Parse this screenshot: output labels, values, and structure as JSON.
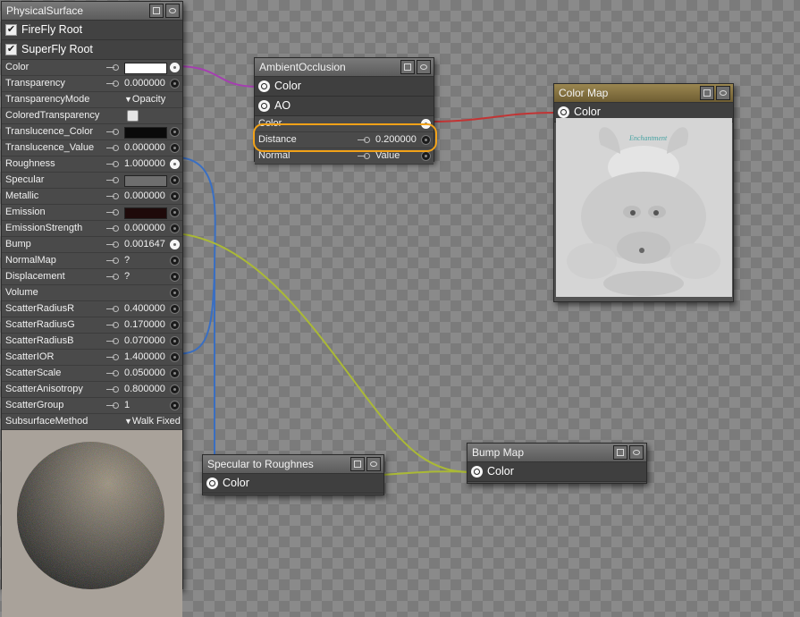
{
  "physical_surface": {
    "title": "PhysicalSurface",
    "headers": [
      {
        "label": "FireFly Root",
        "checked": true
      },
      {
        "label": "SuperFly Root",
        "checked": true
      }
    ],
    "props": [
      {
        "label": "Color",
        "kind": "swatch",
        "color": "#ffffff",
        "socket": "out"
      },
      {
        "label": "Transparency",
        "kind": "value",
        "value": "0.000000",
        "socket": "in"
      },
      {
        "label": "TransparencyMode",
        "kind": "dropdown",
        "value": "Opacity"
      },
      {
        "label": "ColoredTransparency",
        "kind": "checkbox"
      },
      {
        "label": "Translucence_Color",
        "kind": "swatch",
        "color": "#0a0a0a",
        "socket": "in"
      },
      {
        "label": "Translucence_Value",
        "kind": "value",
        "value": "0.000000",
        "socket": "in"
      },
      {
        "label": "Roughness",
        "kind": "value",
        "value": "1.000000",
        "socket": "out"
      },
      {
        "label": "Specular",
        "kind": "swatch",
        "color": "#6e6e6e",
        "socket": "in"
      },
      {
        "label": "Metallic",
        "kind": "value",
        "value": "0.000000",
        "socket": "in"
      },
      {
        "label": "Emission",
        "kind": "swatch",
        "color": "#1e0a0a",
        "socket": "in"
      },
      {
        "label": "EmissionStrength",
        "kind": "value",
        "value": "0.000000",
        "socket": "in"
      },
      {
        "label": "Bump",
        "kind": "value",
        "value": "0.001647",
        "socket": "out"
      },
      {
        "label": "NormalMap",
        "kind": "value",
        "value": "?",
        "socket": "in"
      },
      {
        "label": "Displacement",
        "kind": "value",
        "value": "?",
        "socket": "in"
      },
      {
        "label": "Volume",
        "kind": "none",
        "socket": "in"
      },
      {
        "label": "ScatterRadiusR",
        "kind": "value",
        "value": "0.400000",
        "socket": "in"
      },
      {
        "label": "ScatterRadiusG",
        "kind": "value",
        "value": "0.170000",
        "socket": "in"
      },
      {
        "label": "ScatterRadiusB",
        "kind": "value",
        "value": "0.070000",
        "socket": "in"
      },
      {
        "label": "ScatterIOR",
        "kind": "value",
        "value": "1.400000",
        "socket": "in"
      },
      {
        "label": "ScatterScale",
        "kind": "value",
        "value": "0.050000",
        "socket": "in"
      },
      {
        "label": "ScatterAnisotropy",
        "kind": "value",
        "value": "0.800000",
        "socket": "in"
      },
      {
        "label": "ScatterGroup",
        "kind": "value",
        "value": "1",
        "socket": "in"
      },
      {
        "label": "SubsurfaceMethod",
        "kind": "dropdown",
        "value": "Walk Fixed"
      }
    ]
  },
  "ambient_occlusion": {
    "title": "AmbientOcclusion",
    "outputs": [
      "Color",
      "AO"
    ],
    "props": [
      {
        "label": "Color",
        "kind": "none",
        "socket": "out"
      },
      {
        "label": "Distance",
        "kind": "value",
        "value": "0.200000",
        "socket": "in"
      },
      {
        "label": "Normal",
        "kind": "value",
        "value": "Value",
        "socket": "in"
      }
    ]
  },
  "color_map": {
    "title": "Color Map",
    "output": "Color",
    "image_caption": "Enchantment"
  },
  "specular_to_roughness": {
    "title": "Specular to Roughnes",
    "output": "Color"
  },
  "bump_map": {
    "title": "Bump Map",
    "output": "Color"
  },
  "wire_colors": {
    "purple": "#a53fb0",
    "red": "#c23434",
    "blue": "#3a6fc2",
    "yellow": "#aab935"
  },
  "icons": {
    "title_buttons": [
      "window-icon",
      "eye-icon"
    ],
    "output_socket": "output-socket-icon",
    "input_socket": "input-socket-icon",
    "dropdown": "triangle-down-icon"
  }
}
